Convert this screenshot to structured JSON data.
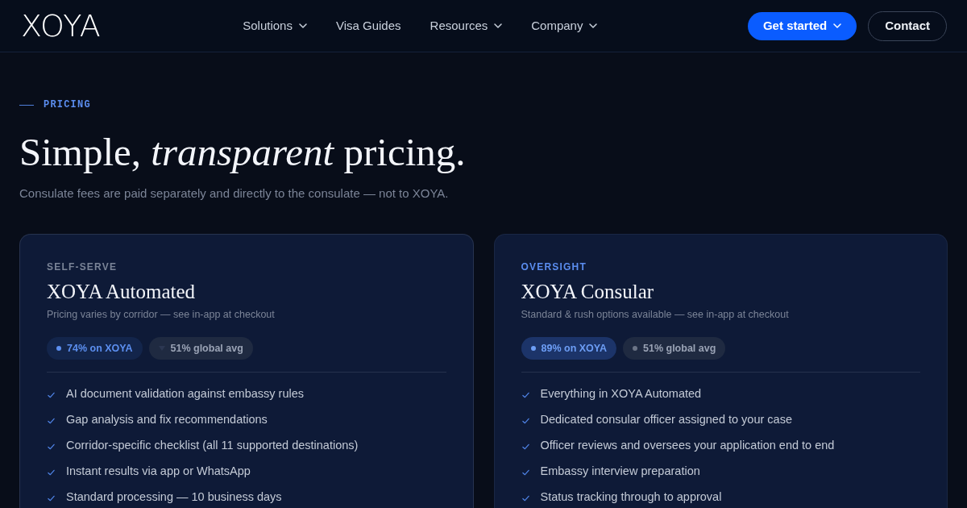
{
  "nav": {
    "logo": "XOYA",
    "links": [
      {
        "label": "Solutions",
        "dropdown": true
      },
      {
        "label": "Visa Guides",
        "dropdown": false
      },
      {
        "label": "Resources",
        "dropdown": true
      },
      {
        "label": "Company",
        "dropdown": true
      }
    ],
    "actions": [
      {
        "label": "Get started",
        "kind": "primary",
        "dropdown": true
      },
      {
        "label": "Contact",
        "kind": "outline",
        "dropdown": false
      }
    ]
  },
  "hero": {
    "eyebrow": "PRICING",
    "title": "Simple, *transparent* pricing.",
    "subtitle": "Consulate fees are paid separately and directly to the consulate — not to XOYA."
  },
  "plans": [
    {
      "tier": "SELF-SERVE",
      "featured": false,
      "name": "XOYA Automated",
      "note": "Pricing varies by corridor — see in-app at checkout",
      "stats": [
        {
          "label": "74% on XOYA",
          "kind": "highlight"
        },
        {
          "label": "51% global avg",
          "kind": "faint"
        }
      ],
      "features": [
        "AI document validation against embassy rules",
        "Gap analysis and fix recommendations",
        "Corridor-specific checklist (all 11 supported destinations)",
        "Instant results via app or WhatsApp",
        "Standard processing — 10 business days"
      ]
    },
    {
      "tier": "OVERSIGHT",
      "featured": true,
      "name": "XOYA Consular",
      "note": "Standard & rush options available — see in-app at checkout",
      "stats": [
        {
          "label": "89% on XOYA",
          "kind": "highlight"
        },
        {
          "label": "51% global avg",
          "kind": "neutral"
        }
      ],
      "features": [
        "Everything in XOYA Automated",
        "Dedicated consular officer assigned to your case",
        "Officer reviews and oversees your application end to end",
        "Embassy interview preparation",
        "Status tracking through to approval"
      ]
    }
  ]
}
